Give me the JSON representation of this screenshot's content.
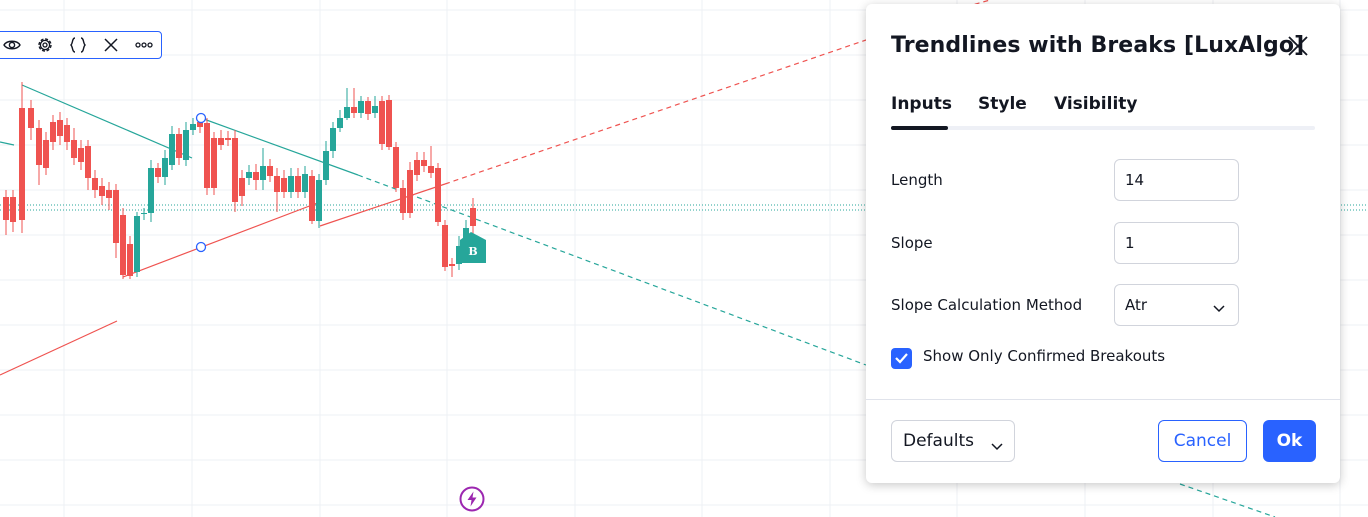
{
  "chart": {
    "break_marker_label": "B",
    "colors": {
      "up": "#26a69a",
      "down": "#ef5350",
      "upper_trendline": "#26a69a",
      "lower_trendline": "#ef5350",
      "grid": "#eef0f4",
      "price_line": "#26a69a"
    }
  },
  "indicator_toolbar": {
    "icons": [
      "eye-icon",
      "gear-icon",
      "source-code-icon",
      "close-icon",
      "more-icon"
    ]
  },
  "dialog": {
    "title": "Trendlines with Breaks [LuxAlgo]",
    "tabs": [
      {
        "label": "Inputs",
        "active": true
      },
      {
        "label": "Style",
        "active": false
      },
      {
        "label": "Visibility",
        "active": false
      }
    ],
    "inputs": {
      "length": {
        "label": "Length",
        "value": "14"
      },
      "slope": {
        "label": "Slope",
        "value": "1"
      },
      "slope_method": {
        "label": "Slope Calculation Method",
        "value": "Atr"
      },
      "confirmed": {
        "label": "Show Only Confirmed Breakouts",
        "checked": true
      }
    },
    "footer": {
      "defaults_label": "Defaults",
      "cancel_label": "Cancel",
      "ok_label": "Ok"
    }
  },
  "accent_color": "#2962ff"
}
